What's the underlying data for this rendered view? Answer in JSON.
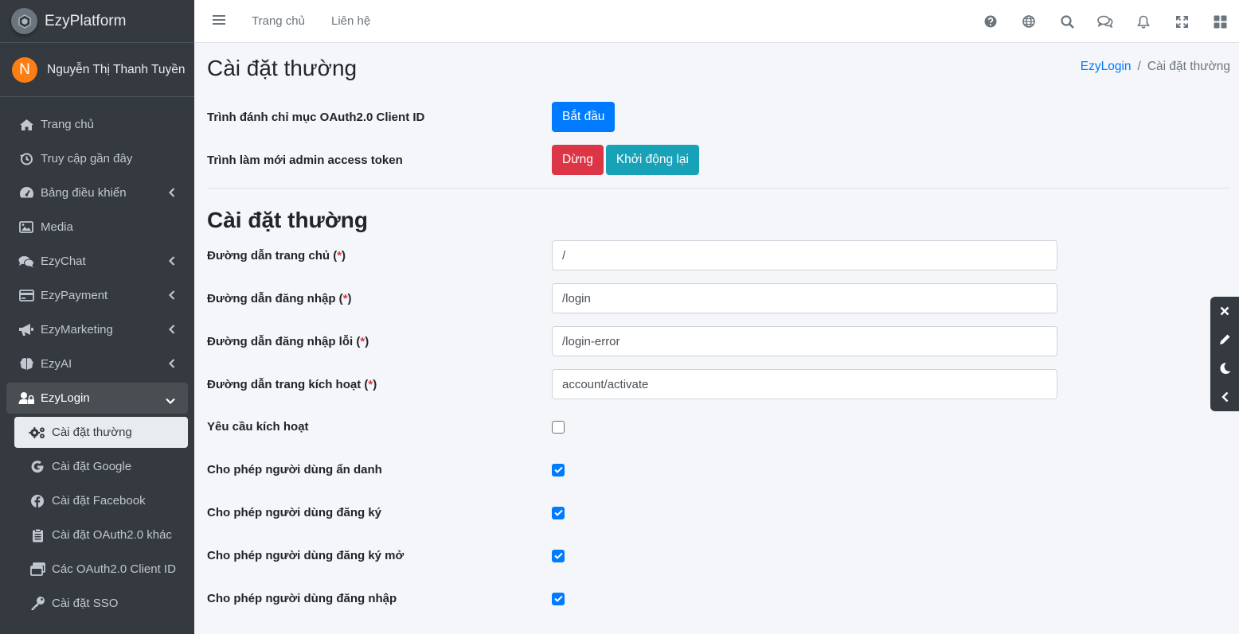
{
  "brand": {
    "name": "EzyPlatform"
  },
  "user": {
    "initial": "N",
    "name": "Nguyễn Thị Thanh Tuyền"
  },
  "sidebar": {
    "items": [
      {
        "label": "Trang chủ",
        "icon": "home-icon"
      },
      {
        "label": "Truy cập gần đây",
        "icon": "history-icon"
      },
      {
        "label": "Bảng điều khiển",
        "icon": "dashboard-icon",
        "expandable": true
      },
      {
        "label": "Media",
        "icon": "image-icon"
      },
      {
        "label": "EzyChat",
        "icon": "chat-icon",
        "expandable": true
      },
      {
        "label": "EzyPayment",
        "icon": "credit-card-icon",
        "expandable": true
      },
      {
        "label": "EzyMarketing",
        "icon": "megaphone-icon",
        "expandable": true
      },
      {
        "label": "EzyAI",
        "icon": "brain-icon",
        "expandable": true
      },
      {
        "label": "EzyLogin",
        "icon": "user-lock-icon",
        "expanded": true
      }
    ],
    "sub_items": [
      {
        "label": "Cài đặt thường",
        "icon": "gears-icon",
        "active": true
      },
      {
        "label": "Cài đặt Google",
        "icon": "google-icon"
      },
      {
        "label": "Cài đặt Facebook",
        "icon": "facebook-icon"
      },
      {
        "label": "Cài đặt OAuth2.0 khác",
        "icon": "clipboard-icon"
      },
      {
        "label": "Các OAuth2.0 Client ID",
        "icon": "windows-icon"
      },
      {
        "label": "Cài đặt SSO",
        "icon": "key-icon"
      }
    ]
  },
  "topbar": {
    "links": [
      "Trang chủ",
      "Liên hệ"
    ],
    "icons": [
      "help-icon",
      "globe-icon",
      "search-icon",
      "comments-icon",
      "bell-icon",
      "fullscreen-icon",
      "apps-icon"
    ]
  },
  "page": {
    "title": "Cài đặt thường",
    "breadcrumb": {
      "parent": "EzyLogin",
      "separator": "/",
      "current": "Cài đặt thường"
    },
    "actions": {
      "indexer_label": "Trình đánh chỉ mục OAuth2.0 Client ID",
      "start_button": "Bắt đầu",
      "refresher_label": "Trình làm mới admin access token",
      "stop_button": "Dừng",
      "restart_button": "Khởi động lại"
    },
    "section_title": "Cài đặt thường",
    "required_mark": "*",
    "fields": [
      {
        "label": "Đường dẫn trang chủ",
        "value": "/"
      },
      {
        "label": "Đường dẫn đăng nhập",
        "value": "/login"
      },
      {
        "label": "Đường dẫn đăng nhập lỗi",
        "value": "/login-error"
      },
      {
        "label": "Đường dẫn trang kích hoạt",
        "value": "account/activate"
      }
    ],
    "checkboxes": [
      {
        "label": "Yêu cầu kích hoạt",
        "checked": false
      },
      {
        "label": "Cho phép người dùng ẩn danh",
        "checked": true
      },
      {
        "label": "Cho phép người dùng đăng ký",
        "checked": true
      },
      {
        "label": "Cho phép người dùng đăng ký mở",
        "checked": true
      },
      {
        "label": "Cho phép người dùng đăng nhập",
        "checked": true
      }
    ]
  },
  "float_toolbar": {
    "icons": [
      "close-icon",
      "pencil-icon",
      "moon-icon",
      "chevron-left-icon"
    ]
  },
  "colors": {
    "sidebar": "#343a40",
    "primary": "#007bff",
    "danger": "#dc3545",
    "info": "#17a2b8",
    "avatar": "#fd7e14"
  }
}
